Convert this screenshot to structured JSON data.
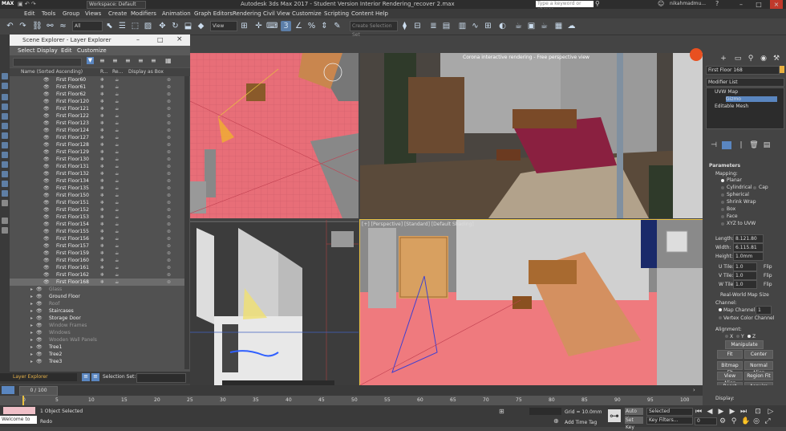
{
  "titlebar": {
    "logo": "MAX",
    "workspace": "Workspace: Default",
    "title": "Autodesk 3ds Max 2017 - Student Version    Interior Rendering_recover 2.max",
    "search_placeholder": "Type a keyword or phrase",
    "user": "nikahmadmu..."
  },
  "menu": [
    "Edit",
    "Tools",
    "Group",
    "Views",
    "Create",
    "Modifiers",
    "Animation",
    "Graph Editors",
    "Rendering",
    "Civil View",
    "Customize",
    "Scripting",
    "Content",
    "Help"
  ],
  "toolbar": {
    "filter": "All",
    "view": "View",
    "selection_set": "Create Selection Set"
  },
  "explorer": {
    "title": "Scene Explorer - Layer Explorer",
    "menu": [
      "Select",
      "Display",
      "Edit",
      "Customize"
    ],
    "columns": [
      "Name (Sorted Ascending)",
      "R...",
      "Re...",
      "Display as Box"
    ],
    "rows": [
      {
        "name": "First Floor60",
        "type": "obj"
      },
      {
        "name": "First Floor61",
        "type": "obj"
      },
      {
        "name": "First Floor62",
        "type": "obj"
      },
      {
        "name": "First Floor120",
        "type": "obj"
      },
      {
        "name": "First Floor121",
        "type": "obj"
      },
      {
        "name": "First Floor122",
        "type": "obj"
      },
      {
        "name": "First Floor123",
        "type": "obj"
      },
      {
        "name": "First Floor124",
        "type": "obj"
      },
      {
        "name": "First Floor127",
        "type": "obj"
      },
      {
        "name": "First Floor128",
        "type": "obj"
      },
      {
        "name": "First Floor129",
        "type": "obj"
      },
      {
        "name": "First Floor130",
        "type": "obj"
      },
      {
        "name": "First Floor131",
        "type": "obj"
      },
      {
        "name": "First Floor132",
        "type": "obj"
      },
      {
        "name": "First Floor134",
        "type": "obj"
      },
      {
        "name": "First Floor135",
        "type": "obj"
      },
      {
        "name": "First Floor150",
        "type": "obj"
      },
      {
        "name": "First Floor151",
        "type": "obj"
      },
      {
        "name": "First Floor152",
        "type": "obj"
      },
      {
        "name": "First Floor153",
        "type": "obj"
      },
      {
        "name": "First Floor154",
        "type": "obj"
      },
      {
        "name": "First Floor155",
        "type": "obj"
      },
      {
        "name": "First Floor156",
        "type": "obj"
      },
      {
        "name": "First Floor157",
        "type": "obj"
      },
      {
        "name": "First Floor159",
        "type": "obj"
      },
      {
        "name": "First Floor160",
        "type": "obj"
      },
      {
        "name": "First Floor161",
        "type": "obj"
      },
      {
        "name": "First Floor162",
        "type": "obj"
      },
      {
        "name": "First Floor168",
        "type": "sel"
      },
      {
        "name": "Glass",
        "type": "dim"
      },
      {
        "name": "Ground Floor",
        "type": "grp"
      },
      {
        "name": "Roof",
        "type": "dim"
      },
      {
        "name": "Staircases",
        "type": "grp"
      },
      {
        "name": "Storage Door",
        "type": "grp"
      },
      {
        "name": "Window Frames",
        "type": "dim"
      },
      {
        "name": "Windows",
        "type": "dim"
      },
      {
        "name": "Wooden Wall Panels",
        "type": "dim"
      },
      {
        "name": "Tree1",
        "type": "grp"
      },
      {
        "name": "Tree2",
        "type": "grp"
      },
      {
        "name": "Tree3",
        "type": "grp"
      }
    ],
    "footer_left": "Layer Explorer",
    "footer_right": "Selection Set:"
  },
  "viewports": {
    "render_label": "Corona interactive rendering - Free perspective view",
    "persp_label": "[+] [Perspective] [Standard] [Default Shading]"
  },
  "command_panel": {
    "object_name": "First Floor 168",
    "modifier_list": "Modifier List",
    "stack": [
      "UVW Map",
      "Gizmo",
      "Editable Mesh"
    ],
    "parameters": "Parameters",
    "mapping_label": "Mapping:",
    "mapping_options": [
      "Planar",
      "Cylindrical",
      "Cap",
      "Spherical",
      "Shrink Wrap",
      "Box",
      "Face",
      "XYZ to UVW"
    ],
    "length_label": "Length:",
    "length_value": "8.121.80",
    "width_label": "Width:",
    "width_value": "6.115.81",
    "height_label": "Height:",
    "height_value": "1.0mm",
    "utile_label": "U Tile:",
    "utile_value": "1.0",
    "vtile_label": "V Tile:",
    "vtile_value": "1.0",
    "wtile_label": "W Tile:",
    "wtile_value": "1.0",
    "flip": "Flip",
    "real_world": "Real-World Map Size",
    "channel_label": "Channel:",
    "map_channel_label": "Map Channel:",
    "map_channel_value": "1",
    "vertex_color": "Vertex Color Channel",
    "alignment_label": "Alignment:",
    "axes": [
      "X",
      "Y",
      "Z"
    ],
    "manipulate": "Manipulate",
    "fit": "Fit",
    "center": "Center",
    "bitmap_fit": "Bitmap Fit",
    "normal_align": "Normal Align",
    "view_align": "View Align",
    "region_fit": "Region Fit",
    "reset": "Reset",
    "acquire": "Acquire",
    "display_label": "Display:"
  },
  "timeline": {
    "frame": "0 / 100",
    "ticks": [
      "0",
      "5",
      "10",
      "15",
      "20",
      "25",
      "30",
      "35",
      "40",
      "45",
      "50",
      "55",
      "60",
      "65",
      "70",
      "75",
      "80",
      "85",
      "90",
      "95",
      "100"
    ],
    "playhead_fraction": 0.0
  },
  "status": {
    "welcome": "Welcome to",
    "selected": "1 Object Selected",
    "redo": "Redo",
    "grid": "Grid = 10.0mm",
    "add_time_tag": "Add Time Tag",
    "auto_key": "Auto Key",
    "set_key": "Set Key",
    "selected_dd": "Selected",
    "key_filters": "Key Filters...",
    "frame_value": "0"
  }
}
